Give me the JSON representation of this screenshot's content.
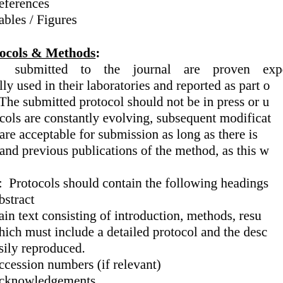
{
  "list_top": {
    "references": "eferences",
    "tables_figures": "ables / Figures"
  },
  "section": {
    "heading": "ocols & Methods",
    "heading_colon": ":"
  },
  "paragraph": {
    "line1_a": "submitted",
    "line1_b": "to",
    "line1_c": "the",
    "line1_d": "journal",
    "line1_e": "are",
    "line1_f": "proven",
    "line1_g": "experi",
    "line2": "lly used in their laboratories and reported as part o",
    "line3": "The submitted protocol should not be in press or u",
    "line4": "cols are constantly evolving, subsequent modificat",
    "line5": "are acceptable for submission as long as there is",
    "line6": "and previous publications of the method, as this w"
  },
  "headings_intro": ":  Protocols should contain the following headings",
  "headings_list": {
    "abstract": "bstract",
    "main_text_1": "ain text consisting of introduction, methods, resu",
    "main_text_2": "hich must include a detailed protocol and the desc",
    "main_text_3": "sily reproduced.",
    "accession": "ccession numbers (if relevant)",
    "acknowledgements": "cknowledgements"
  }
}
